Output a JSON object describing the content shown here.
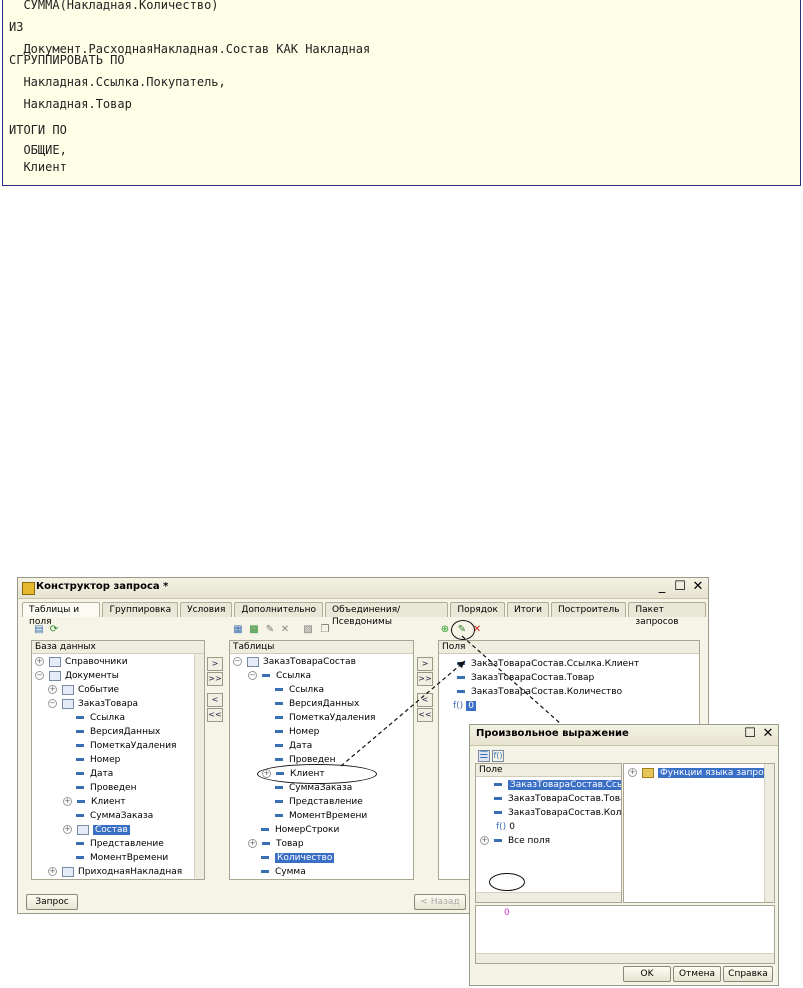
{
  "code_lines": [
    "  СУММА(Накладная.Количество)",
    "ИЗ",
    "  Документ.РасходнаяНакладная.Состав КАК Накладная",
    "СГРУППИРОВАТЬ ПО",
    "  Накладная.Ссылка.Покупатель,",
    "  Накладная.Товар",
    "",
    "ИТОГИ ПО",
    "  ОБЩИЕ,",
    "  Клиент"
  ],
  "window": {
    "title": "Конструктор запроса *",
    "tabs": [
      "Таблицы и поля",
      "Группировка",
      "Условия",
      "Дополнительно",
      "Объединения/Псевдонимы",
      "Порядок",
      "Итоги",
      "Построитель",
      "Пакет запросов"
    ],
    "db_panel": {
      "header": "База данных",
      "items": [
        "Справочники",
        "Документы",
        "Событие",
        "ЗаказТовара",
        "Ссылка",
        "ВерсияДанных",
        "ПометкаУдаления",
        "Номер",
        "Дата",
        "Проведен",
        "Клиент",
        "СуммаЗаказа",
        "Состав",
        "Представление",
        "МоментВремени",
        "ПриходнаяНакладная"
      ]
    },
    "tables_panel": {
      "header": "Таблицы",
      "items": [
        "ЗаказТовараСостав",
        "Ссылка",
        "Ссылка",
        "ВерсияДанных",
        "ПометкаУдаления",
        "Номер",
        "Дата",
        "Проведен",
        "Клиент",
        "СуммаЗаказа",
        "Представление",
        "МоментВремени",
        "НомерСтроки",
        "Товар",
        "Количество",
        "Сумма"
      ]
    },
    "fields_panel": {
      "header": "Поля",
      "items": [
        "ЗаказТовараСостав.Ссылка.Клиент",
        "ЗаказТовараСостав.Товар",
        "ЗаказТовараСостав.Количество",
        "0"
      ]
    },
    "arrows": [
      ">",
      ">>",
      "<",
      "<<"
    ],
    "query_button": "Запрос",
    "back_button": "< Назад"
  },
  "dialog": {
    "title": "Произвольное выражение",
    "fields_header": "Поле",
    "fields": [
      "ЗаказТовараСостав.Ссылка.Клиент",
      "ЗаказТовараСостав.Товар",
      "ЗаказТовараСостав.Количество",
      "0",
      "Все поля"
    ],
    "functions_item": "Функции языка запросов",
    "expression": "0",
    "ok": "OK",
    "cancel": "Отмена",
    "help": "Справка"
  },
  "colors": {
    "selection": "#3a6fc6",
    "code_bg": "#ffffe8",
    "expression_text": "#cc33cc"
  },
  "icons": [
    "table-icon",
    "field-icon",
    "function-icon",
    "add-icon",
    "edit-icon",
    "delete-icon",
    "close-icon",
    "maximize-icon",
    "minimize-icon"
  ]
}
